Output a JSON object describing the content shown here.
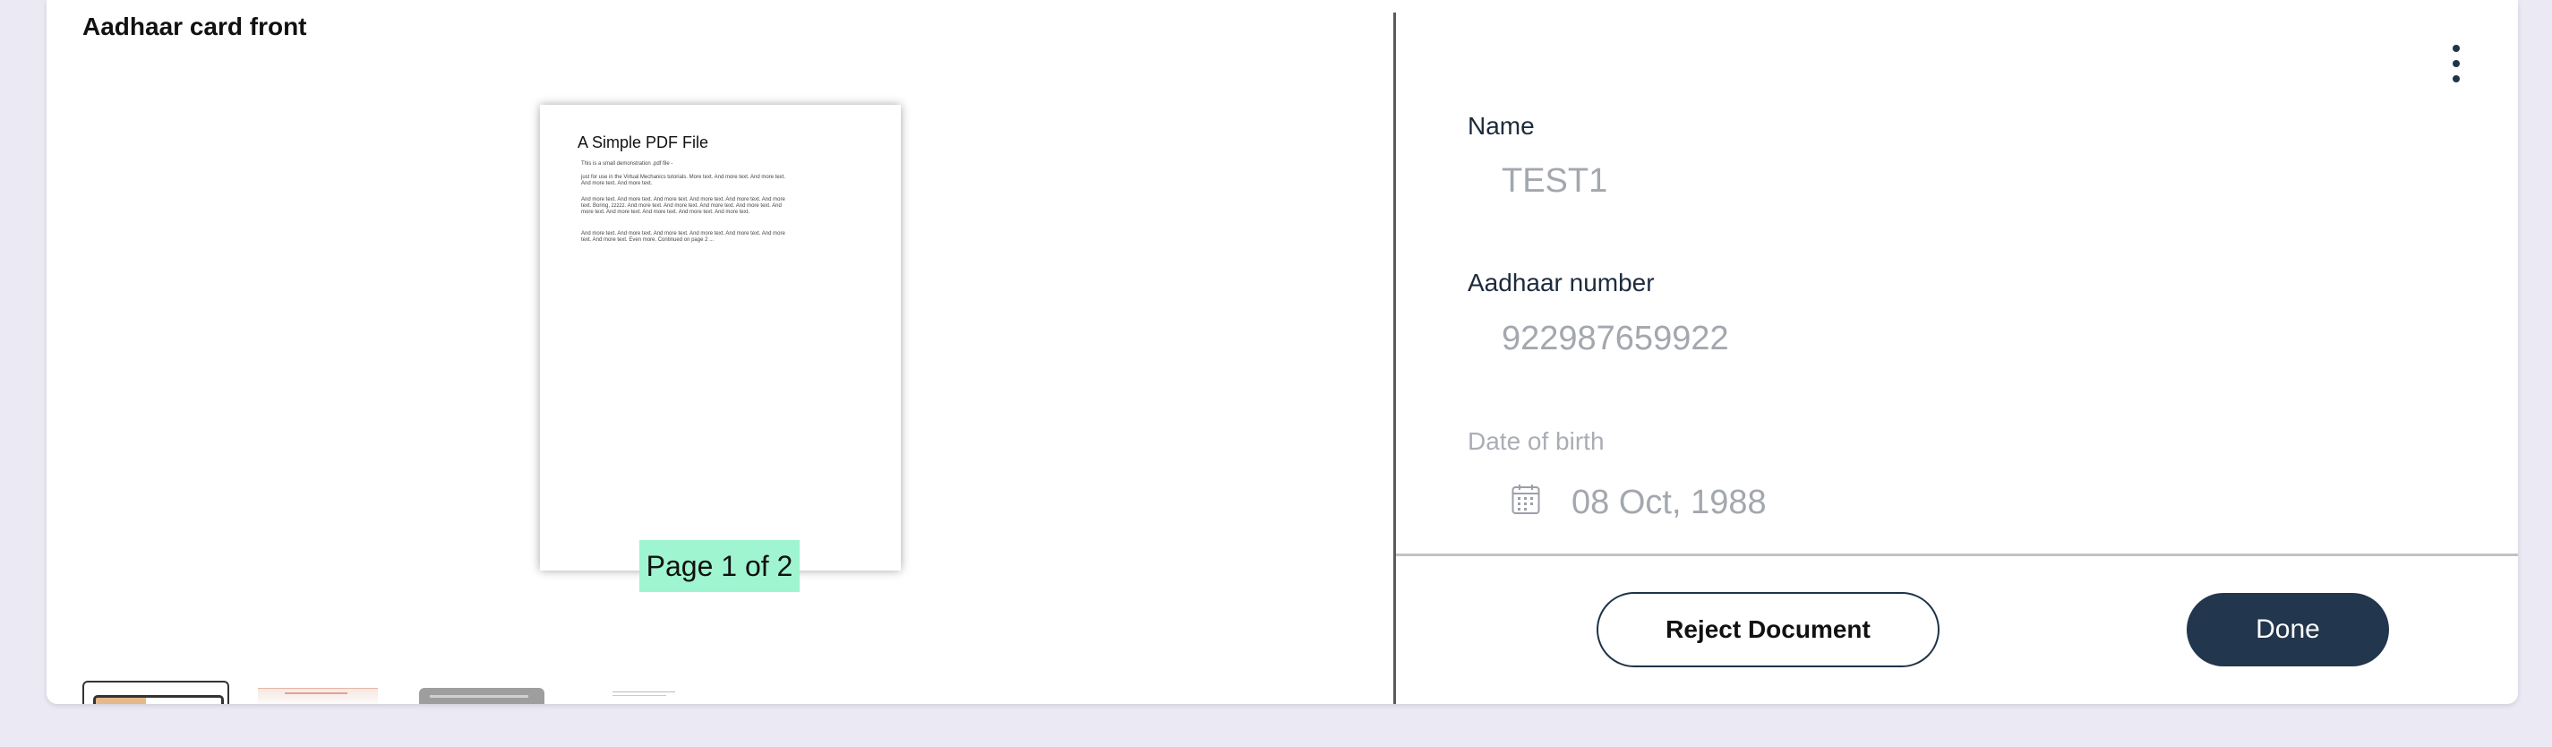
{
  "document": {
    "title": "Aadhaar card front",
    "pdf_heading": "A Simple PDF File",
    "pdf_paragraphs": [
      "This is a small demonstration .pdf file -",
      "just for use in the Virtual Mechanics tutorials. More text. And more text. And more text. And more text. And more text.",
      "And more text. And more text. And more text. And more text. And more text. And more text. Boring, zzzzz. And more text. And more text. And more text. And more text. And more text. And more text. And more text. And more text. And more text.",
      "And more text. And more text. And more text. And more text. And more text. And more text. And more text. Even more. Continued on page 2 ..."
    ],
    "page_indicator": "Page 1 of 2"
  },
  "form": {
    "name_label": "Name",
    "name_value": "TEST1",
    "aadhaar_label": "Aadhaar number",
    "aadhaar_value": "922987659922",
    "dob_label": "Date of birth",
    "dob_value": "08 Oct, 1988"
  },
  "actions": {
    "reject_label": "Reject Document",
    "done_label": "Done"
  },
  "icons": {
    "menu": "kebab-menu-icon",
    "date": "calendar-icon"
  },
  "colors": {
    "primary": "#22364d",
    "page_indicator_bg": "#9ef5d0",
    "background": "#ebeaf4"
  }
}
